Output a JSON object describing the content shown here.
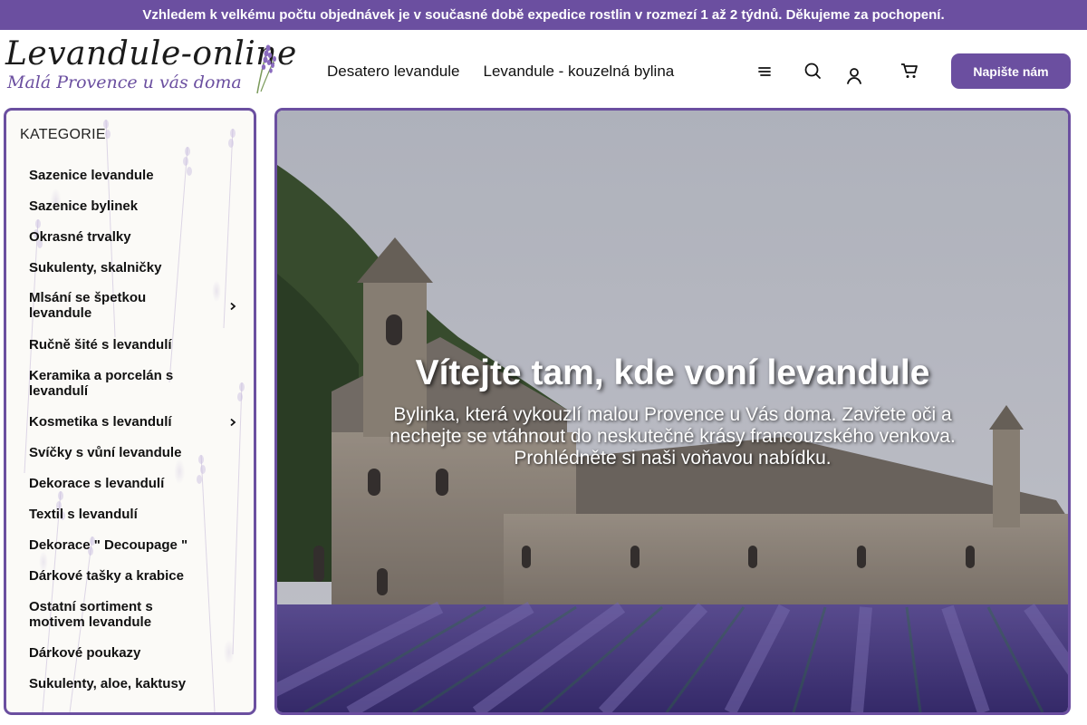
{
  "announcement": "Vzhledem k velkému počtu objednávek je v současné době expedice rostlin v rozmezí 1 až 2 týdnů. Děkujeme za pochopení.",
  "logo": {
    "title": "Levandule-online",
    "subtitle": "Malá Provence u vás doma"
  },
  "nav": {
    "items": [
      "Desatero levandule",
      "Levandule - kouzelná bylina"
    ]
  },
  "header": {
    "contact_button": "Napište nám",
    "icons": [
      "menu-icon",
      "search-icon",
      "user-icon",
      "cart-icon"
    ]
  },
  "sidebar": {
    "title": "KATEGORIE",
    "items": [
      {
        "label": "Sazenice levandule",
        "has_submenu": false
      },
      {
        "label": "Sazenice bylinek",
        "has_submenu": false
      },
      {
        "label": "Okrasné trvalky",
        "has_submenu": false
      },
      {
        "label": "Sukulenty, skalničky",
        "has_submenu": false
      },
      {
        "label": "Mlsání se špetkou levandule",
        "has_submenu": true
      },
      {
        "label": "Ručně šité s levandulí",
        "has_submenu": false
      },
      {
        "label": "Keramika a porcelán s levandulí",
        "has_submenu": false
      },
      {
        "label": "Kosmetika s levandulí",
        "has_submenu": true
      },
      {
        "label": "Svíčky s vůní levandule",
        "has_submenu": false
      },
      {
        "label": "Dekorace s levandulí",
        "has_submenu": false
      },
      {
        "label": "Textil s levandulí",
        "has_submenu": false
      },
      {
        "label": "Dekorace \" Decoupage \"",
        "has_submenu": false
      },
      {
        "label": "Dárkové tašky a krabice",
        "has_submenu": false
      },
      {
        "label": "Ostatní sortiment s motivem levandule",
        "has_submenu": false
      },
      {
        "label": "Dárkové poukazy",
        "has_submenu": false
      },
      {
        "label": "Sukulenty, aloe, kaktusy",
        "has_submenu": false
      }
    ]
  },
  "hero": {
    "title": "Vítejte tam, kde voní levandule",
    "text": "Bylinka, která vykouzlí malou Provence u Vás doma. Zavřete oči a nechejte se vtáhnout do neskutečné krásy francouzského venkova. Prohlédněte si naši voňavou nabídku."
  },
  "colors": {
    "accent": "#6b4fa0",
    "text": "#111111",
    "background": "#ffffff"
  }
}
